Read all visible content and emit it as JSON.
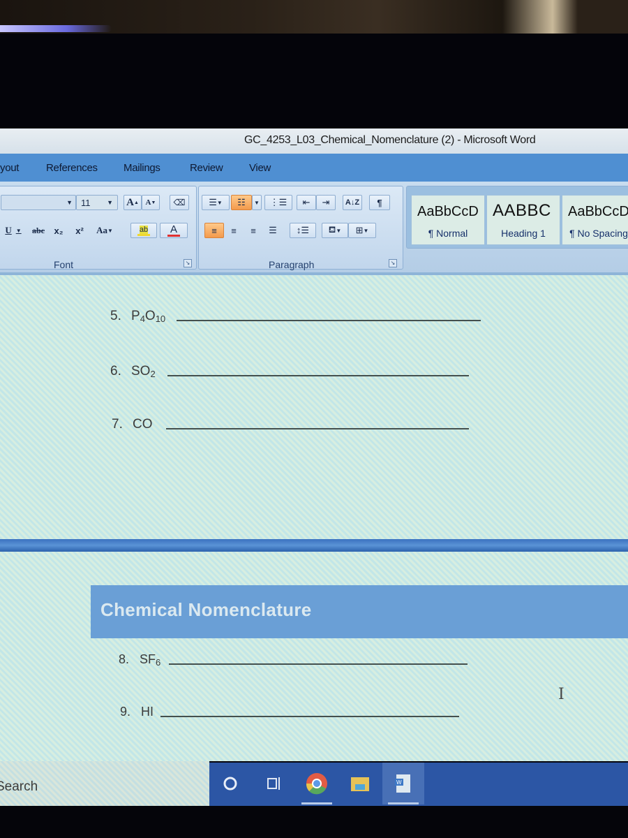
{
  "window": {
    "title": "GC_4253_L03_Chemical_Nomenclature (2) - Microsoft Word"
  },
  "ribbon_tabs": [
    {
      "label": "yout"
    },
    {
      "label": "References"
    },
    {
      "label": "Mailings"
    },
    {
      "label": "Review"
    },
    {
      "label": "View"
    }
  ],
  "font_group": {
    "label": "Font",
    "font_size": "11",
    "grow_font": "A",
    "shrink_font": "A",
    "underline": "U",
    "strikethrough": "abc",
    "subscript": "x₂",
    "superscript": "x²",
    "change_case": "Aa",
    "highlight": "ab",
    "font_color": "A",
    "highlight_color": "#f0d830",
    "font_color_bar": "#e03030"
  },
  "paragraph_group": {
    "label": "Paragraph",
    "show_marks": "¶",
    "sort": "A↓Z"
  },
  "styles": [
    {
      "sample": "AaBbCcD",
      "name": "¶ Normal"
    },
    {
      "sample": "AABBC",
      "name": "Heading 1"
    },
    {
      "sample": "AaBbCcD",
      "name": "¶ No Spacing"
    }
  ],
  "document": {
    "items_top": [
      {
        "num": "5.",
        "formula_parts": [
          [
            "P",
            ""
          ],
          [
            "4",
            "sub"
          ],
          [
            "O",
            ""
          ],
          [
            "10",
            "sub"
          ]
        ]
      },
      {
        "num": "6.",
        "formula_parts": [
          [
            "SO",
            ""
          ],
          [
            "2",
            "sub"
          ]
        ]
      },
      {
        "num": "7.",
        "formula_parts": [
          [
            "CO",
            ""
          ]
        ]
      }
    ],
    "section_header": "Chemical Nomenclature",
    "items_bottom": [
      {
        "num": "8.",
        "formula_parts": [
          [
            "SF",
            ""
          ],
          [
            "6",
            "sub"
          ]
        ]
      },
      {
        "num": "9.",
        "formula_parts": [
          [
            "HI",
            ""
          ]
        ]
      }
    ]
  },
  "taskbar": {
    "search_label": "Search",
    "items": [
      {
        "name": "cortana"
      },
      {
        "name": "task-view"
      },
      {
        "name": "chrome"
      },
      {
        "name": "file-explorer"
      },
      {
        "name": "word"
      }
    ]
  },
  "colors": {
    "tab_bar": "#4f8fd2",
    "banner": "#6a9fd6",
    "taskbar": "#2c56a5",
    "active_button": "#f39a4c"
  }
}
